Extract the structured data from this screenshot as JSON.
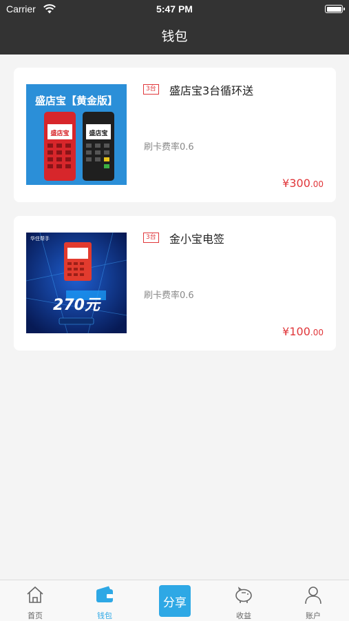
{
  "status_bar": {
    "carrier": "Carrier",
    "time": "5:47 PM"
  },
  "header": {
    "title": "钱包"
  },
  "products": [
    {
      "badge": "3台",
      "title": "盛店宝3台循环送",
      "rate": "刷卡费率0.6",
      "price_symbol": "¥",
      "price_int": "300",
      "price_dec": ".00",
      "image_text": "盛店宝【黄金版】",
      "image_screen_text": "盛店宝"
    },
    {
      "badge": "3台",
      "title": "金小宝电签",
      "rate": "刷卡费率0.6",
      "price_symbol": "¥",
      "price_int": "100",
      "price_dec": ".00",
      "image_text": "270元",
      "image_top_text": "华住帮手"
    }
  ],
  "tabbar": {
    "items": [
      {
        "label": "首页",
        "icon": "home-icon",
        "active": false
      },
      {
        "label": "钱包",
        "icon": "wallet-icon",
        "active": true
      },
      {
        "label": "分享",
        "icon": "share-button",
        "active": false
      },
      {
        "label": "收益",
        "icon": "piggy-bank-icon",
        "active": false
      },
      {
        "label": "账户",
        "icon": "user-icon",
        "active": false
      }
    ]
  },
  "colors": {
    "header_bg": "#333333",
    "accent": "#2ea8e5",
    "price": "#e0363a"
  }
}
